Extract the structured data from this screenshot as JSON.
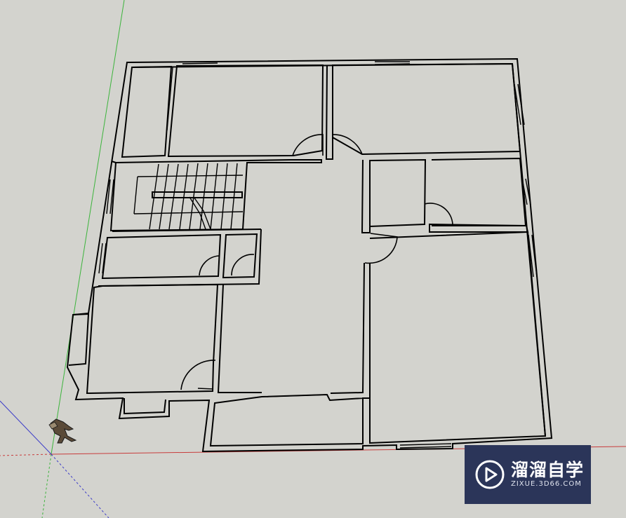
{
  "app": {
    "name": "SketchUp 3D floor plan viewport"
  },
  "scene": {
    "background_color": "#d3d3ce",
    "axes": {
      "red": "#c83c3c",
      "green": "#3cb43c",
      "blue": "#3c3cc8"
    },
    "model": "floor-plan-walls-doors-stairs",
    "figure": "scale-figure"
  },
  "watermark": {
    "icon": "play-icon",
    "title": "溜溜自学",
    "subtitle": "ZIXUE.3D66.COM",
    "background": "#2b3559"
  }
}
